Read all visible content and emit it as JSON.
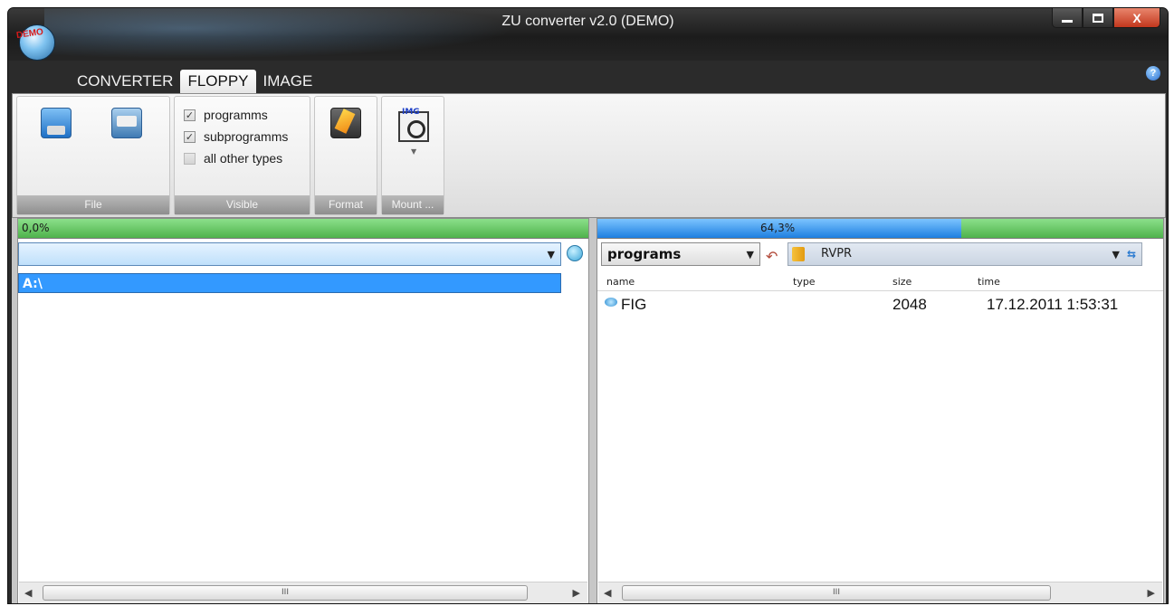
{
  "window": {
    "title": "ZU converter v2.0 (DEMO)",
    "logo_badge": "DEMO",
    "close_label": "X"
  },
  "tabs": [
    {
      "label": "CONVERTER",
      "active": false
    },
    {
      "label": "FLOPPY",
      "active": true
    },
    {
      "label": "IMAGE",
      "active": false
    }
  ],
  "help_icon": "?",
  "ribbon": {
    "groups": {
      "file": "File",
      "visible": "Visible",
      "format": "Format",
      "mount": "Mount ..."
    },
    "mount_icon_text": "IMG",
    "checkboxes": [
      {
        "label": "programms",
        "checked": true
      },
      {
        "label": "subprogramms",
        "checked": true
      },
      {
        "label": "all other types",
        "checked": false
      }
    ]
  },
  "left_panel": {
    "progress_text": "0,0%",
    "progress_value": 0.0,
    "drive_combo_value": "",
    "drive_item": "A:\\",
    "scroll_thumb": "III"
  },
  "right_panel": {
    "progress_text": "64,3%",
    "progress_value": 0.643,
    "filter_combo_value": "programs",
    "path": "RVPR",
    "columns": [
      "name",
      "type",
      "size",
      "time"
    ],
    "files": [
      {
        "name": "FIG",
        "type": "",
        "size": "2048",
        "time": "17.12.2011 1:53:31"
      }
    ],
    "scroll_thumb": "III"
  },
  "colors": {
    "progress_green": "#4fb24c",
    "progress_blue": "#1e7fe0",
    "selection_blue": "#3399ff"
  }
}
